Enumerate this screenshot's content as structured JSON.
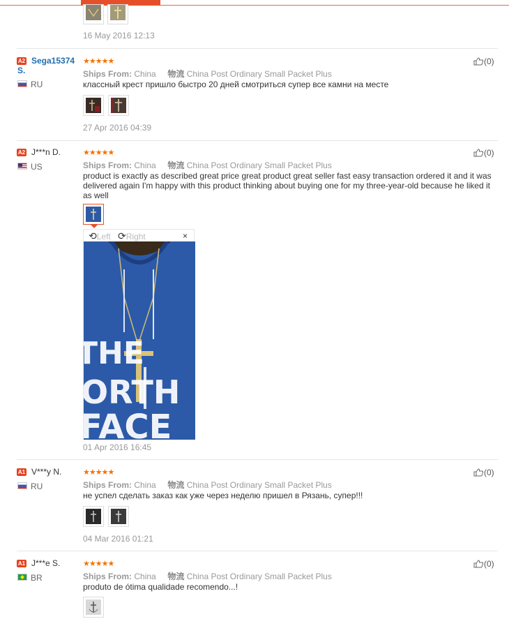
{
  "labels": {
    "ships_from": "Ships From:"
  },
  "reviews": [
    {
      "date": "16 May 2016 12:13"
    },
    {
      "badge": "A2",
      "name": "Sega15374",
      "name_cont": "S.",
      "country": "RU",
      "stars": "★★★★★",
      "ships_country": "China",
      "logistics_icon": "物流",
      "shipping": "China Post Ordinary Small Packet Plus",
      "text": "классный крест пришло быстро 20 дней смотриться супер все камни на месте",
      "date": "27 Apr 2016 04:39",
      "helpful": "(0)"
    },
    {
      "badge": "A2",
      "name": "J***n D.",
      "country": "US",
      "stars": "★★★★★",
      "ships_country": "China",
      "logistics_icon": "物流",
      "shipping": "China Post Ordinary Small Packet Plus",
      "text": "product is exactly as described great price great product great seller fast easy transaction ordered it and it was delivered again I'm happy with this product thinking about buying one for my three-year-old because he liked it as well",
      "viewer": {
        "left": "Left",
        "right": "Right",
        "close": "×",
        "photo_text": [
          "THE",
          "ORTH",
          "FACE"
        ]
      },
      "date": "01 Apr 2016 16:45",
      "helpful": "(0)"
    },
    {
      "badge": "A1",
      "name": "V***y N.",
      "country": "RU",
      "stars": "★★★★★",
      "ships_country": "China",
      "logistics_icon": "物流",
      "shipping": "China Post Ordinary Small Packet Plus",
      "text": "не успел сделать заказ как уже через неделю пришел в Рязань, супер!!!",
      "date": "04 Mar 2016 01:21",
      "helpful": "(0)"
    },
    {
      "badge": "A1",
      "name": "J***e S.",
      "country": "BR",
      "stars": "★★★★★",
      "ships_country": "China",
      "logistics_icon": "物流",
      "shipping": "China Post Ordinary Small Packet Plus",
      "text": "produto de ótima qualidade recomendo...!",
      "helpful": "(0)"
    }
  ],
  "colors": {
    "accent": "#e5502a",
    "star": "#f57200",
    "link": "#1f6fb2",
    "meta": "#999999"
  }
}
